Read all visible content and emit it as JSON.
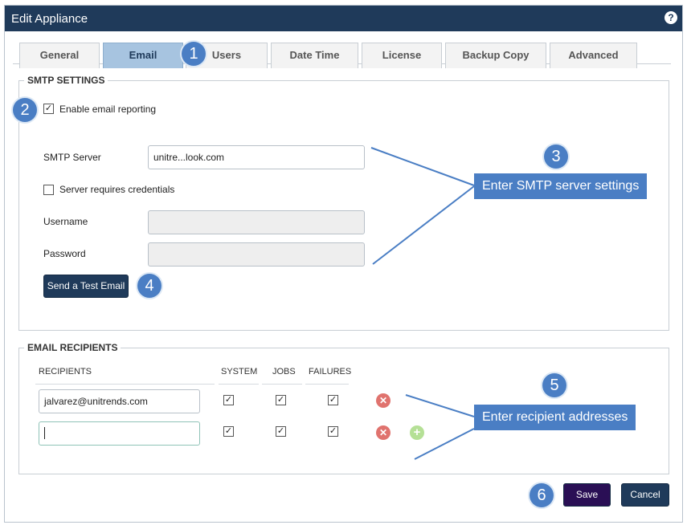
{
  "dialog": {
    "title": "Edit Appliance",
    "help_icon": "?"
  },
  "tabs": [
    "General",
    "Email",
    "Users",
    "Date Time",
    "License",
    "Backup Copy",
    "Advanced"
  ],
  "active_tab": "Email",
  "smtp": {
    "legend": "SMTP SETTINGS",
    "enable_label": "Enable email reporting",
    "enable_checked": true,
    "server_label": "SMTP Server",
    "server_value": "unitre...look.com",
    "creds_label": "Server requires credentials",
    "creds_checked": false,
    "username_label": "Username",
    "password_label": "Password",
    "test_button": "Send a Test Email"
  },
  "recipients": {
    "legend": "EMAIL RECIPIENTS",
    "columns": [
      "RECIPIENTS",
      "SYSTEM",
      "JOBS",
      "FAILURES"
    ],
    "rows": [
      {
        "email": "jalvarez@unitrends.com",
        "system": true,
        "jobs": true,
        "failures": true
      },
      {
        "email": "",
        "system": true,
        "jobs": true,
        "failures": true
      }
    ]
  },
  "footer": {
    "save": "Save",
    "cancel": "Cancel"
  },
  "annotations": {
    "badges": [
      "1",
      "2",
      "3",
      "4",
      "5",
      "6"
    ],
    "smtp_callout": "Enter SMTP server settings",
    "recipients_callout": "Enter recipient addresses"
  },
  "colors": {
    "titlebar": "#1f3a5a",
    "accent": "#4a7ec4",
    "tab_active": "#a7c4e0",
    "save": "#2a0f55"
  }
}
